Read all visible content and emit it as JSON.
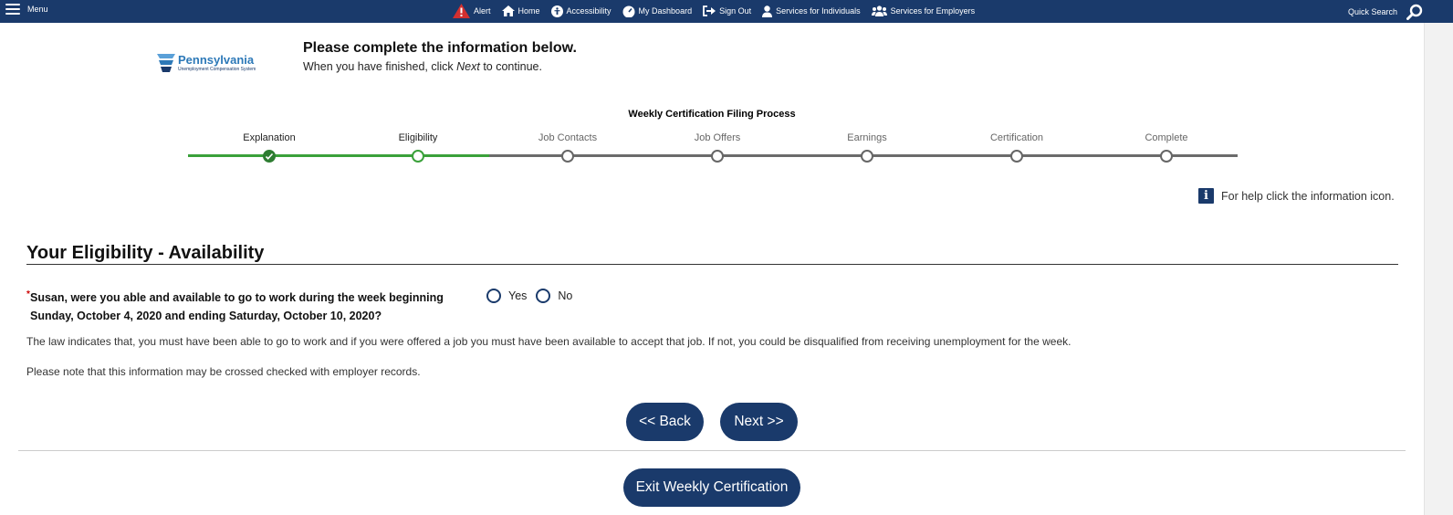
{
  "nav": {
    "menu_label": "Menu",
    "links": [
      {
        "label": "Alert",
        "icon": "alert-icon"
      },
      {
        "label": "Home",
        "icon": "home-icon"
      },
      {
        "label": "Accessibility",
        "icon": "accessibility-icon"
      },
      {
        "label": "My Dashboard",
        "icon": "dashboard-icon"
      },
      {
        "label": "Sign Out",
        "icon": "sign-out-icon"
      },
      {
        "label": "Services for Individuals",
        "icon": "person-icon"
      },
      {
        "label": "Services for Employers",
        "icon": "group-icon"
      }
    ],
    "quick_search": "Quick Search"
  },
  "logo": {
    "main": "Pennsylvania",
    "sub": "Unemployment Compensation System"
  },
  "header": {
    "title": "Please complete the information below.",
    "sub_before": "When you have finished, click ",
    "sub_em": "Next",
    "sub_after": " to continue."
  },
  "process": {
    "title": "Weekly Certification Filing Process",
    "steps": [
      {
        "label": "Explanation",
        "state": "done"
      },
      {
        "label": "Eligibility",
        "state": "active"
      },
      {
        "label": "Job Contacts",
        "state": "inactive"
      },
      {
        "label": "Job Offers",
        "state": "inactive"
      },
      {
        "label": "Earnings",
        "state": "inactive"
      },
      {
        "label": "Certification",
        "state": "inactive"
      },
      {
        "label": "Complete",
        "state": "inactive"
      }
    ]
  },
  "help_text": "For help click the information icon.",
  "section": {
    "title": "Your Eligibility - Availability",
    "question_line1": "Susan, were you able and available to go to work during the week beginning",
    "question_line2": "Sunday, October 4, 2020 and ending Saturday, October 10, 2020?",
    "required_mark": "*",
    "options": [
      "Yes",
      "No"
    ],
    "para1": "The law indicates that, you must have been able to go to work and if you were offered a job you must have been available to accept that job. If not, you could be disqualified from receiving unemployment for the week.",
    "para2": "Please note that this information may be crossed checked with employer records."
  },
  "buttons": {
    "back": "<< Back",
    "next": "Next >>",
    "exit": "Exit Weekly Certification"
  },
  "colors": {
    "navy": "#1a3a6b",
    "progress_green": "#3aa13a",
    "done_green": "#2e7d32"
  }
}
